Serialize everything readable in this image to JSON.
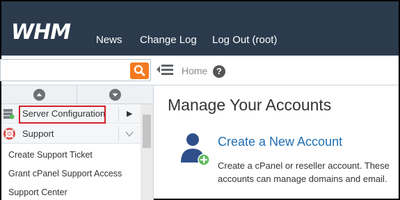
{
  "header": {
    "logo": "WHM",
    "nav": [
      {
        "label": "News"
      },
      {
        "label": "Change Log"
      },
      {
        "label": "Log Out (root)"
      }
    ]
  },
  "toolbar": {
    "search_value": "",
    "breadcrumb": "Home",
    "help_symbol": "?"
  },
  "sidebar": {
    "categories": [
      {
        "label": "Server Configuration",
        "icon": "server-config-icon",
        "expanded": false,
        "highlighted": true
      },
      {
        "label": "Support",
        "icon": "support-lifebuoy-icon",
        "expanded": true
      }
    ],
    "support_items": [
      {
        "label": "Create Support Ticket"
      },
      {
        "label": "Grant cPanel Support Access"
      },
      {
        "label": "Support Center"
      }
    ]
  },
  "main": {
    "title": "Manage Your Accounts",
    "action": {
      "label": "Create a New Account",
      "description_line1": "Create a cPanel or reseller account. These",
      "description_line2": "accounts can manage domains and email."
    }
  },
  "colors": {
    "header_bg": "#2b3a4d",
    "search_button": "#f47a20",
    "link": "#1f6fb2",
    "highlight": "#d0202a",
    "add_badge": "#5cb85c",
    "user_icon": "#2f4f8a"
  }
}
